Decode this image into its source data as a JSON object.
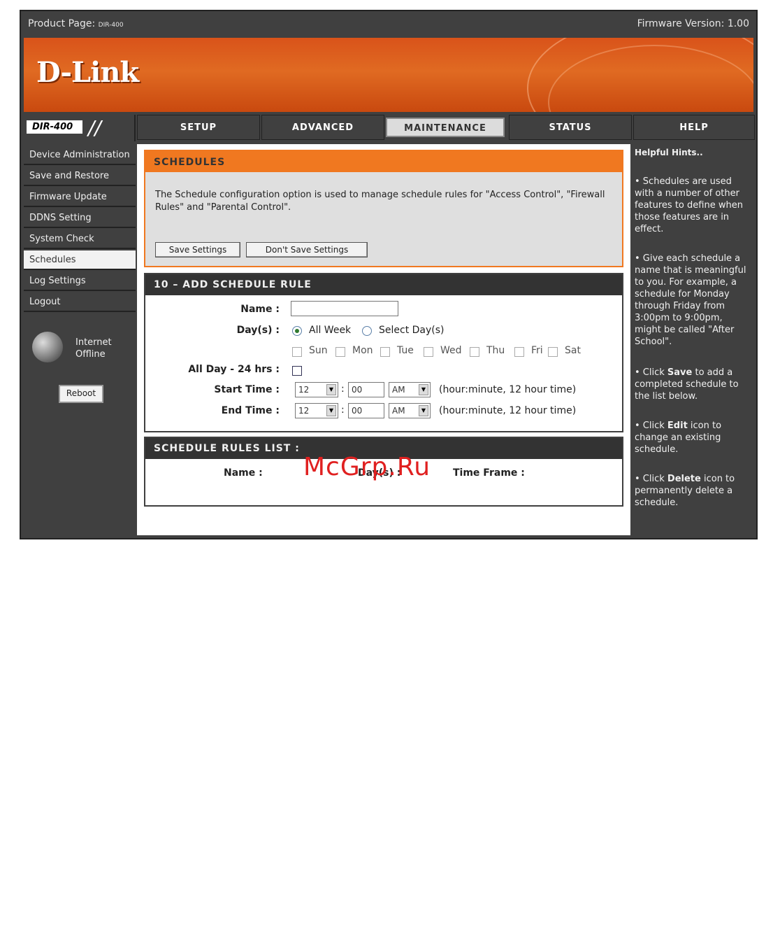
{
  "header": {
    "product_label": "Product Page:",
    "product_model": "DIR-400",
    "firmware": "Firmware Version: 1.00",
    "logo": "D-Link"
  },
  "model_tag": "DIR-400",
  "tabs": [
    "SETUP",
    "ADVANCED",
    "MAINTENANCE",
    "STATUS",
    "HELP"
  ],
  "sidebar": {
    "items": [
      "Device Administration",
      "Save and Restore",
      "Firmware Update",
      "DDNS Setting",
      "System Check",
      "Schedules",
      "Log Settings",
      "Logout"
    ],
    "internet_line1": "Internet",
    "internet_line2": "Offline",
    "reboot": "Reboot"
  },
  "schedules": {
    "title": "SCHEDULES",
    "description": "The Schedule configuration option is used to manage schedule rules for \"Access Control\", \"Firewall Rules\" and \"Parental Control\".",
    "save_button": "Save Settings",
    "dont_save_button": "Don't Save Settings"
  },
  "add_rule": {
    "title": "10 – ADD SCHEDULE RULE",
    "name_label": "Name :",
    "name_value": "",
    "days_label": "Day(s) :",
    "all_week": "All Week",
    "select_days": "Select Day(s)",
    "days": [
      "Sun",
      "Mon",
      "Tue",
      "Wed",
      "Thu",
      "Fri",
      "Sat"
    ],
    "all_day_label": "All Day - 24 hrs :",
    "start_label": "Start Time :",
    "end_label": "End Time :",
    "start_hour": "12",
    "start_min": "00",
    "start_ampm": "AM",
    "end_hour": "12",
    "end_min": "00",
    "end_ampm": "AM",
    "colon": ":",
    "time_hint": "(hour:minute, 12 hour time)"
  },
  "rules_list": {
    "title": "SCHEDULE RULES LIST :",
    "col_name": "Name :",
    "col_days": "Day(s) :",
    "col_time": "Time Frame :"
  },
  "help": {
    "title": "Helpful Hints..",
    "hint1": "• Schedules are used with a number of other features to define when those features are in effect.",
    "hint2": "• Give each schedule a name that is meaningful to you. For example, a schedule for Monday through Friday from 3:00pm to 9:00pm, might be called \"After School\".",
    "hint3_pre": "• Click ",
    "hint3_bold": "Save",
    "hint3_post": " to add a completed schedule to the list below.",
    "hint4_pre": "• Click ",
    "hint4_bold": "Edit",
    "hint4_post": " icon to change an existing schedule.",
    "hint5_pre": "• Click ",
    "hint5_bold": "Delete",
    "hint5_post": " icon to permanently delete a schedule."
  },
  "watermark": "McGrp.Ru"
}
